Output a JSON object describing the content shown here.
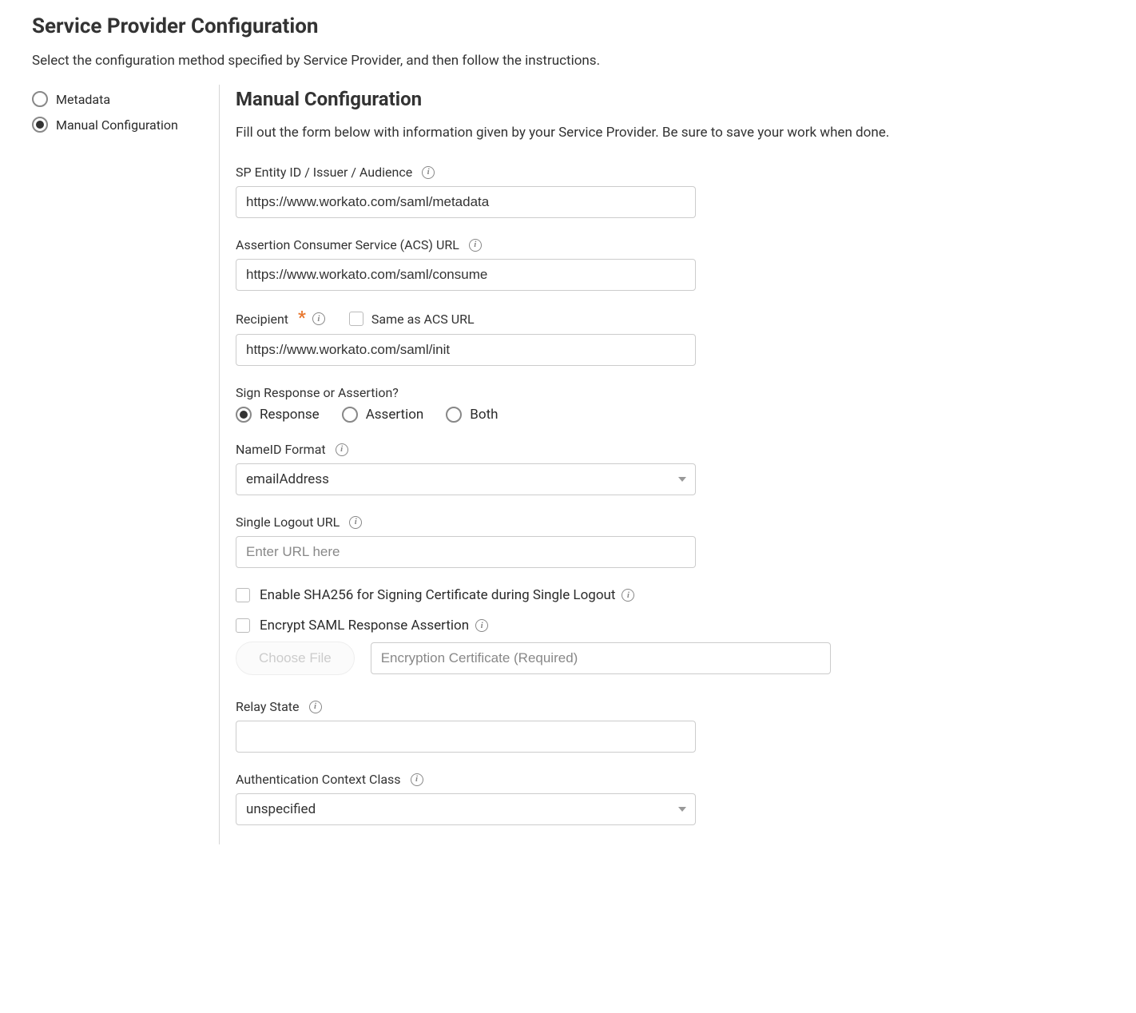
{
  "page": {
    "title": "Service Provider Configuration",
    "subtext": "Select the configuration method specified by Service Provider, and then follow the instructions."
  },
  "sidebar": {
    "options": [
      {
        "label": "Metadata",
        "selected": false
      },
      {
        "label": "Manual Configuration",
        "selected": true
      }
    ]
  },
  "section": {
    "title": "Manual Configuration",
    "subtext": "Fill out the form below with information given by your Service Provider. Be sure to save your work when done."
  },
  "fields": {
    "sp_entity": {
      "label": "SP Entity ID / Issuer / Audience",
      "value": "https://www.workato.com/saml/metadata"
    },
    "acs_url": {
      "label": "Assertion Consumer Service (ACS) URL",
      "value": "https://www.workato.com/saml/consume"
    },
    "recipient": {
      "label": "Recipient",
      "same_as_label": "Same as ACS URL",
      "value": "https://www.workato.com/saml/init"
    },
    "sign": {
      "label": "Sign Response or Assertion?",
      "options": [
        "Response",
        "Assertion",
        "Both"
      ],
      "selected": "Response"
    },
    "nameid": {
      "label": "NameID Format",
      "value": "emailAddress"
    },
    "slo_url": {
      "label": "Single Logout URL",
      "placeholder": "Enter URL here",
      "value": ""
    },
    "sha256": {
      "label": "Enable SHA256 for Signing Certificate during Single Logout"
    },
    "encrypt": {
      "label": "Encrypt SAML Response Assertion",
      "choose_file": "Choose File",
      "cert_placeholder": "Encryption Certificate (Required)"
    },
    "relay": {
      "label": "Relay State",
      "value": ""
    },
    "authn": {
      "label": "Authentication Context Class",
      "value": "unspecified"
    }
  }
}
